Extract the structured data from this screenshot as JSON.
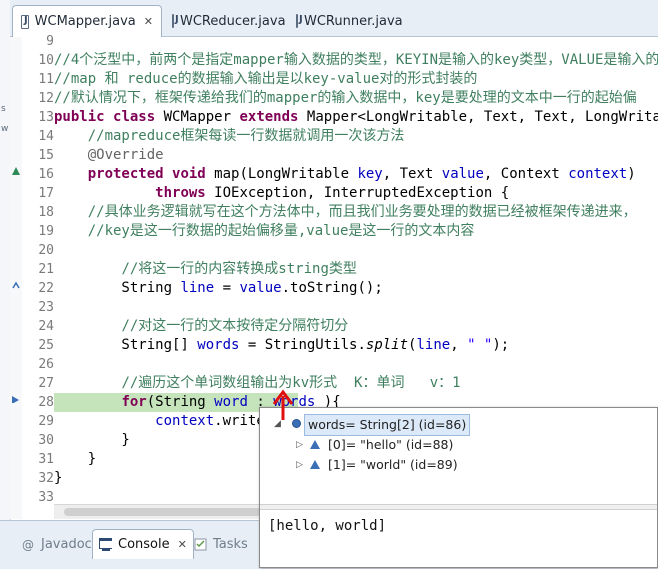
{
  "tabs": [
    {
      "label": "WCMapper.java",
      "active": true,
      "closable": true
    },
    {
      "label": "WCReducer.java",
      "active": false,
      "closable": false
    },
    {
      "label": "WCRunner.java",
      "active": false,
      "closable": false
    }
  ],
  "left_fragments": [
    "s",
    "w"
  ],
  "code": {
    "lines": [
      {
        "num": "9",
        "segs": []
      },
      {
        "num": "10",
        "segs": [
          {
            "c": "cmt",
            "t": "//4个泛型中，前两个是指定mapper输入数据的类型，KEYIN是输入的key类型，VALUE是输入的"
          }
        ]
      },
      {
        "num": "11",
        "segs": [
          {
            "c": "cmt",
            "t": "//map 和 reduce的数据输入输出是以key-value对的形式封装的"
          }
        ]
      },
      {
        "num": "12",
        "segs": [
          {
            "c": "cmt",
            "t": "//默认情况下，框架传递给我们的mapper的输入数据中，key是要处理的文本中一行的起始偏"
          }
        ]
      },
      {
        "num": "13",
        "segs": [
          {
            "c": "kw",
            "t": "public"
          },
          {
            "c": "plain",
            "t": " "
          },
          {
            "c": "kw",
            "t": "class"
          },
          {
            "c": "plain",
            "t": " WCMapper "
          },
          {
            "c": "kw",
            "t": "extends"
          },
          {
            "c": "plain",
            "t": " Mapper<LongWritable, Text, Text, LongWritable>{"
          }
        ]
      },
      {
        "num": "14",
        "segs": [
          {
            "c": "plain",
            "t": "    "
          },
          {
            "c": "cmt",
            "t": "//mapreduce框架每读一行数据就调用一次该方法"
          }
        ]
      },
      {
        "num": "15",
        "segs": [
          {
            "c": "plain",
            "t": "    "
          },
          {
            "c": "ann",
            "t": "@Override"
          }
        ]
      },
      {
        "num": "16",
        "segs": [
          {
            "c": "plain",
            "t": "    "
          },
          {
            "c": "kw",
            "t": "protected"
          },
          {
            "c": "plain",
            "t": " "
          },
          {
            "c": "kw",
            "t": "void"
          },
          {
            "c": "plain",
            "t": " map(LongWritable "
          },
          {
            "c": "var",
            "t": "key"
          },
          {
            "c": "plain",
            "t": ", Text "
          },
          {
            "c": "var",
            "t": "value"
          },
          {
            "c": "plain",
            "t": ", Context "
          },
          {
            "c": "var",
            "t": "context"
          },
          {
            "c": "plain",
            "t": ")"
          }
        ]
      },
      {
        "num": "17",
        "segs": [
          {
            "c": "plain",
            "t": "            "
          },
          {
            "c": "kw",
            "t": "throws"
          },
          {
            "c": "plain",
            "t": " IOException, InterruptedException {"
          }
        ]
      },
      {
        "num": "18",
        "segs": [
          {
            "c": "plain",
            "t": "    "
          },
          {
            "c": "cmt",
            "t": "//具体业务逻辑就写在这个方法体中，而且我们业务要处理的数据已经被框架传递进来，"
          }
        ]
      },
      {
        "num": "19",
        "segs": [
          {
            "c": "plain",
            "t": "    "
          },
          {
            "c": "cmt",
            "t": "//key是这一行数据的起始偏移量,value是这一行的文本内容"
          }
        ]
      },
      {
        "num": "20",
        "segs": []
      },
      {
        "num": "21",
        "segs": [
          {
            "c": "plain",
            "t": "        "
          },
          {
            "c": "cmt",
            "t": "//将这一行的内容转换成string类型"
          }
        ]
      },
      {
        "num": "22",
        "segs": [
          {
            "c": "plain",
            "t": "        String "
          },
          {
            "c": "var",
            "t": "line"
          },
          {
            "c": "plain",
            "t": " = "
          },
          {
            "c": "var",
            "t": "value"
          },
          {
            "c": "plain",
            "t": ".toString();"
          }
        ]
      },
      {
        "num": "23",
        "segs": []
      },
      {
        "num": "24",
        "segs": [
          {
            "c": "plain",
            "t": "        "
          },
          {
            "c": "cmt",
            "t": "//对这一行的文本按待定分隔符切分"
          }
        ]
      },
      {
        "num": "25",
        "segs": [
          {
            "c": "plain",
            "t": "        String[] "
          },
          {
            "c": "var",
            "t": "words"
          },
          {
            "c": "plain",
            "t": " = StringUtils."
          },
          {
            "c": "ital",
            "t": "split"
          },
          {
            "c": "plain",
            "t": "("
          },
          {
            "c": "var",
            "t": "line"
          },
          {
            "c": "plain",
            "t": ", "
          },
          {
            "c": "str",
            "t": "\" \""
          },
          {
            "c": "plain",
            "t": ");"
          }
        ]
      },
      {
        "num": "26",
        "segs": []
      },
      {
        "num": "27",
        "segs": [
          {
            "c": "plain",
            "t": "        "
          },
          {
            "c": "cmt",
            "t": "//遍历这个单词数组输出为kv形式  K：单词   v：1"
          }
        ]
      },
      {
        "num": "28",
        "current": true,
        "segs": [
          {
            "c": "plain",
            "t": "        "
          },
          {
            "c": "kw",
            "t": "for"
          },
          {
            "c": "plain",
            "t": "(String "
          },
          {
            "c": "var",
            "t": "word"
          },
          {
            "c": "plain",
            "t": " : "
          },
          {
            "c": "var",
            "t": "words"
          },
          {
            "c": "plain",
            "t": " ){"
          }
        ]
      },
      {
        "num": "29",
        "segs": [
          {
            "c": "plain",
            "t": "            "
          },
          {
            "c": "var",
            "t": "context"
          },
          {
            "c": "plain",
            "t": ".write"
          }
        ]
      },
      {
        "num": "30",
        "segs": [
          {
            "c": "plain",
            "t": "        }"
          }
        ]
      },
      {
        "num": "31",
        "segs": [
          {
            "c": "plain",
            "t": "    }"
          }
        ]
      },
      {
        "num": "32",
        "segs": [
          {
            "c": "plain",
            "t": "}"
          }
        ]
      },
      {
        "num": "33",
        "segs": []
      }
    ]
  },
  "bottom_tabs": [
    {
      "label": "Javadoc",
      "icon": "at-icon",
      "active": false
    },
    {
      "label": "Console",
      "icon": "console-icon",
      "active": true
    },
    {
      "label": "Tasks",
      "icon": "tasks-icon",
      "active": false
    }
  ],
  "popup": {
    "root": {
      "label": "words= String[2]  (id=86)",
      "expanded": true
    },
    "children": [
      {
        "label": "[0]= \"hello\" (id=88)"
      },
      {
        "label": "[1]= \"world\" (id=89)"
      }
    ],
    "detail": "[hello, world]"
  },
  "colors": {
    "comment": "#3f7f5f",
    "keyword": "#7f0055",
    "variable": "#0000c0",
    "string": "#2a00ff",
    "current_line": "#c6e4bc",
    "cursor_arrow": "#e01010"
  }
}
